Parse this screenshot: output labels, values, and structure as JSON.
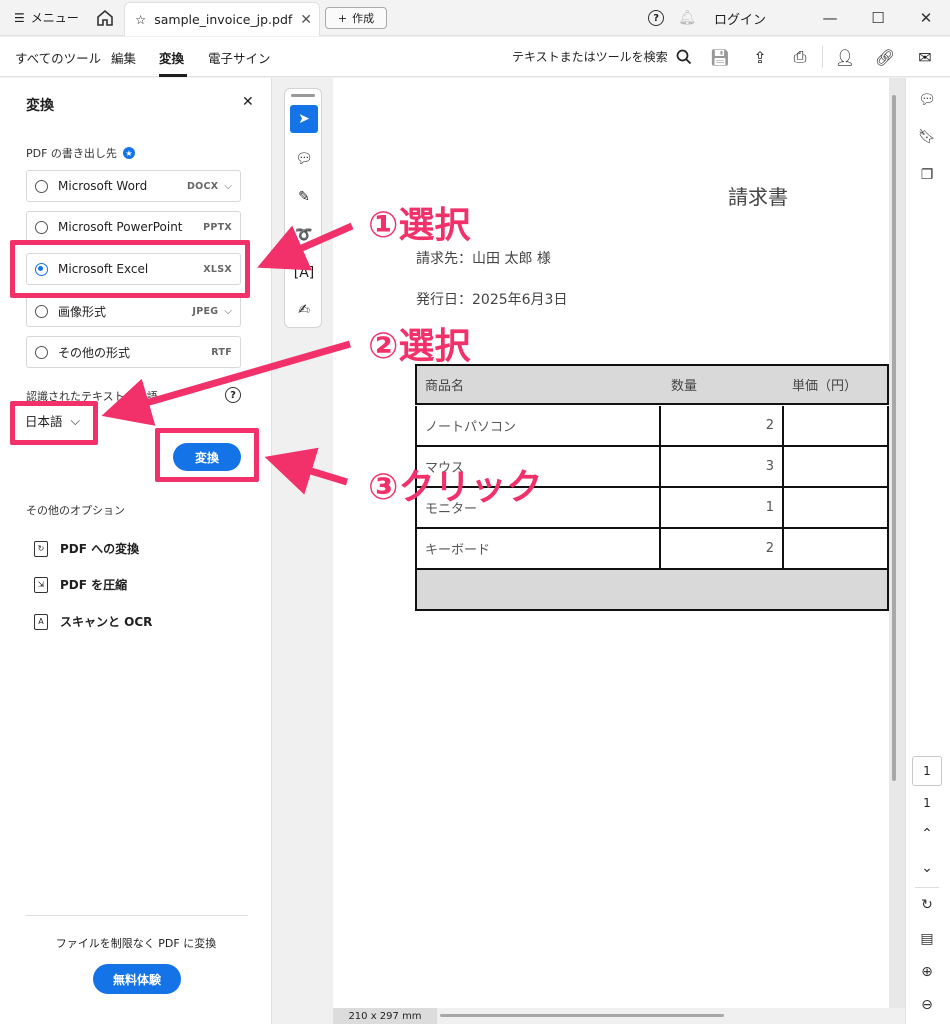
{
  "titlebar": {
    "menu_label": "メニュー",
    "tab_title": "sample_invoice_jp.pdf",
    "new_label": "作成",
    "login_label": "ログイン"
  },
  "toolbar": {
    "nav": [
      "すべてのツール",
      "編集",
      "変換",
      "電子サイン"
    ],
    "active_nav": "変換",
    "search_label": "テキストまたはツールを検索"
  },
  "panel": {
    "title": "変換",
    "export_label": "PDF の書き出し先",
    "options": [
      {
        "label": "Microsoft Word",
        "ext": "DOCX",
        "has_dropdown": true,
        "selected": false
      },
      {
        "label": "Microsoft PowerPoint",
        "ext": "PPTX",
        "has_dropdown": false,
        "selected": false
      },
      {
        "label": "Microsoft Excel",
        "ext": "XLSX",
        "has_dropdown": false,
        "selected": true
      },
      {
        "label": "画像形式",
        "ext": "JPEG",
        "has_dropdown": true,
        "selected": false
      },
      {
        "label": "その他の形式",
        "ext": "RTF",
        "has_dropdown": false,
        "selected": false
      }
    ],
    "lang_label": "認識されたテキストの言語",
    "lang_value": "日本語",
    "convert_button": "変換",
    "other_options_label": "その他のオプション",
    "tools": [
      "PDF への変換",
      "PDF を圧縮",
      "スキャンと OCR"
    ],
    "free_text": "ファイルを制限なく PDF に変換",
    "trial_button": "無料体験"
  },
  "document": {
    "title": "請求書",
    "bill_to": "請求先：山田 太郎 様",
    "issue_date": "発行日：2025年6月3日",
    "table_headers": [
      "商品名",
      "数量",
      "単価（円）"
    ],
    "rows": [
      {
        "name": "ノートパソコン",
        "qty": "2"
      },
      {
        "name": "マウス",
        "qty": "3"
      },
      {
        "name": "モニター",
        "qty": "1"
      },
      {
        "name": "キーボード",
        "qty": "2"
      }
    ],
    "page_size": "210 x 297 mm"
  },
  "pager": {
    "current": "1",
    "total": "1"
  },
  "annotations": {
    "step1": "①選択",
    "step2": "②選択",
    "step3": "③クリック",
    "color": "#f2306a"
  },
  "colors": {
    "accent": "#1473e6"
  }
}
